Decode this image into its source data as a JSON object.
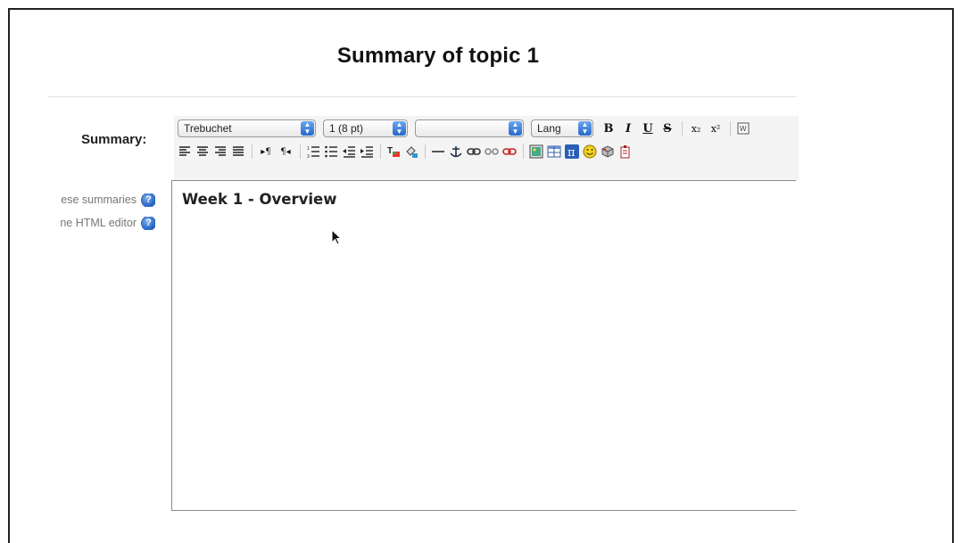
{
  "page": {
    "title": "Summary of topic 1"
  },
  "form": {
    "summary_label": "Summary:",
    "help_links": [
      {
        "text": "ese summaries"
      },
      {
        "text": "ne HTML editor"
      }
    ]
  },
  "toolbar": {
    "font_family": "Trebuchet",
    "font_size": "1 (8 pt)",
    "format": "",
    "lang": "Lang",
    "bold": "B",
    "italic": "I",
    "underline": "U",
    "strike": "S",
    "subscript": "x₂",
    "superscript": "x²",
    "icons_row2": [
      "justify-left-icon",
      "justify-center-icon",
      "justify-right-icon",
      "justify-full-icon",
      "ltr-icon",
      "rtl-icon",
      "ordered-list-icon",
      "unordered-list-icon",
      "outdent-icon",
      "indent-icon",
      "text-color-icon",
      "background-color-icon",
      "horizontal-rule-icon",
      "anchor-icon",
      "link-icon",
      "unlink-icon",
      "nolink-icon",
      "image-icon",
      "table-icon",
      "math-icon",
      "smiley-icon",
      "special-char-icon",
      "paste-icon"
    ]
  },
  "editor": {
    "content": "Week 1 - Overview"
  }
}
